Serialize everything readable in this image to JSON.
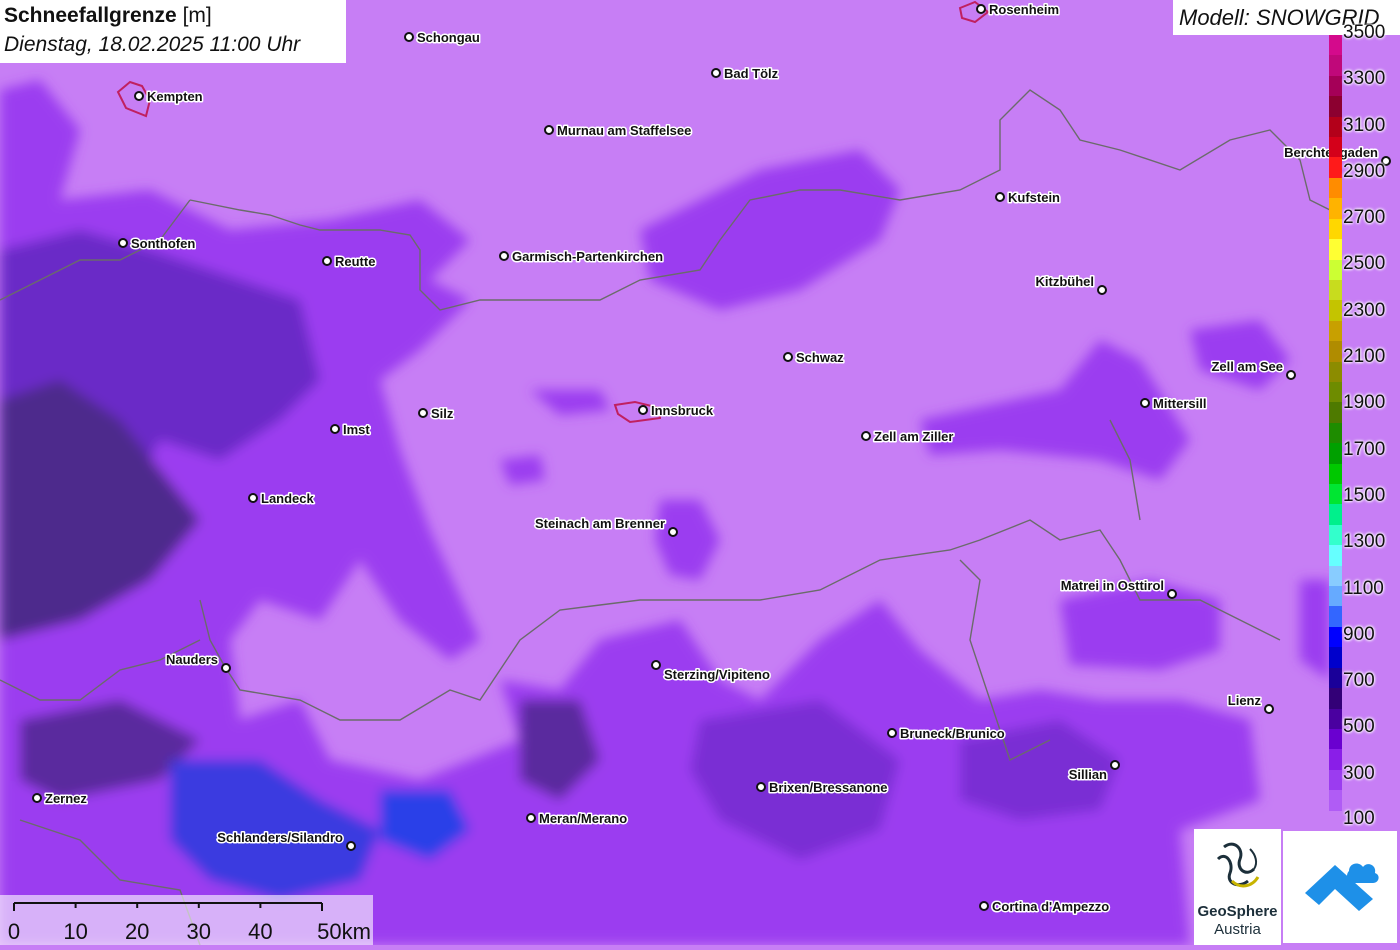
{
  "title": {
    "main": "Schneefallgrenze",
    "unit": "[m]",
    "datetime": "Dienstag, 18.02.2025 11:00 Uhr"
  },
  "model_label": "Modell: SNOWGRID",
  "colors": {
    "background": "#c77ef5",
    "low_snowline": "#9b3cf0",
    "very_low": "#5a2a9e",
    "blue_zone": "#2c3fe8"
  },
  "cities": [
    {
      "name": "Rosenheim"
    },
    {
      "name": "Schongau"
    },
    {
      "name": "Bad Tölz"
    },
    {
      "name": "Kempten"
    },
    {
      "name": "Murnau am Staffelsee"
    },
    {
      "name": "Berchtesgaden"
    },
    {
      "name": "Kufstein"
    },
    {
      "name": "Sonthofen"
    },
    {
      "name": "Reutte"
    },
    {
      "name": "Garmisch-Partenkirchen"
    },
    {
      "name": "Kitzbühel"
    },
    {
      "name": "Schwaz"
    },
    {
      "name": "Zell am See"
    },
    {
      "name": "Mittersill"
    },
    {
      "name": "Innsbruck"
    },
    {
      "name": "Silz"
    },
    {
      "name": "Imst"
    },
    {
      "name": "Zell am Ziller"
    },
    {
      "name": "Landeck"
    },
    {
      "name": "Steinach am Brenner"
    },
    {
      "name": "Matrei in Osttirol"
    },
    {
      "name": "Nauders"
    },
    {
      "name": "Sterzing/Vipiteno"
    },
    {
      "name": "Lienz"
    },
    {
      "name": "Bruneck/Brunico"
    },
    {
      "name": "Sillian"
    },
    {
      "name": "Brixen/Bressanone"
    },
    {
      "name": "Zernez"
    },
    {
      "name": "Meran/Merano"
    },
    {
      "name": "Schlanders/Silandro"
    },
    {
      "name": "Cortina d'Ampezzo"
    }
  ],
  "legend": {
    "labels": [
      "3500",
      "3300",
      "3100",
      "2900",
      "2700",
      "2500",
      "2300",
      "2100",
      "1900",
      "1700",
      "1500",
      "1300",
      "1100",
      "900",
      "700",
      "500",
      "300",
      "100"
    ],
    "colors": [
      "#d40a8c",
      "#c0087a",
      "#a50058",
      "#8c0030",
      "#b3001a",
      "#d4001a",
      "#ff1a1a",
      "#ff8c00",
      "#ffb300",
      "#ffd700",
      "#ffff33",
      "#ccff33",
      "#c8dc1e",
      "#c4c400",
      "#c8a000",
      "#b08c00",
      "#8c8c00",
      "#6e8c00",
      "#4e7a00",
      "#1e8c00",
      "#00a000",
      "#00c800",
      "#00e632",
      "#00f08c",
      "#33ffcc",
      "#66ffff",
      "#88ccff",
      "#66aaff",
      "#3366ff",
      "#0000ff",
      "#0000cc",
      "#1a0099",
      "#330077",
      "#4a00a0",
      "#6a00d0",
      "#8a1ee8",
      "#9b3cf0",
      "#b05cf5",
      "#c77ef5"
    ]
  },
  "scale": {
    "ticks": [
      "0",
      "10",
      "20",
      "30",
      "40",
      "50km"
    ]
  },
  "logos": {
    "geosphere_line1": "GeoSphere",
    "geosphere_line2": "Austria"
  }
}
